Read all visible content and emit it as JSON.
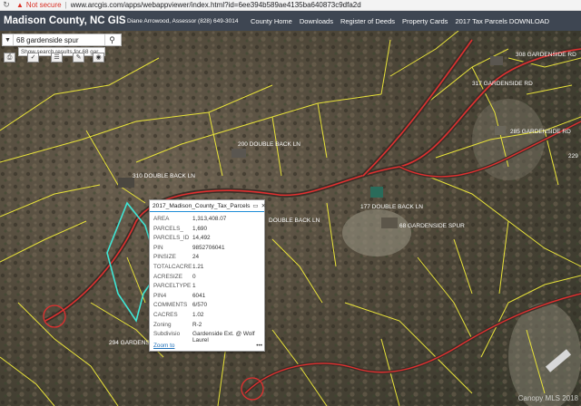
{
  "browser": {
    "security_label": "Not secure",
    "url": "www.arcgis.com/apps/webappviewer/index.html?id=6ee394b589ae4135ba640873c9dfa2d"
  },
  "header": {
    "title": "Madison County, NC GIS",
    "assessor": "Diane Arrowood, Assessor (828) 649-3014",
    "nav": [
      "County Home",
      "Downloads",
      "Register of Deeds",
      "Property Cards",
      "2017 Tax Parcels DOWNLOAD"
    ]
  },
  "search": {
    "value": "68 gardenside spur",
    "suggestion": "Show search results for 68 gar..."
  },
  "map_labels": [
    "308 GARDENSIDE RD",
    "317 GARDENSIDE RD",
    "285 GARDENSIDE RD",
    "229",
    "200 DOUBLE BACK LN",
    "310 DOUBLE BACK LN",
    "DOUBLE BACK LN",
    "177 DOUBLE BACK LN",
    "68 GARDENSIDE SPUR",
    "294 GARDENS"
  ],
  "popup": {
    "title": "2017_Madison_County_Tax_Parcels",
    "fields": [
      {
        "key": "AREA",
        "value": "1,313,408.07"
      },
      {
        "key": "PARCELS_",
        "value": "1,690"
      },
      {
        "key": "PARCELS_ID",
        "value": "14,492"
      },
      {
        "key": "PIN",
        "value": "9852706041"
      },
      {
        "key": "PINSIZE",
        "value": "24"
      },
      {
        "key": "TOTALCACRE",
        "value": "1.21"
      },
      {
        "key": "ACRESIZE",
        "value": "0"
      },
      {
        "key": "PARCELTYPE",
        "value": "1"
      },
      {
        "key": "PIN4",
        "value": "6041"
      },
      {
        "key": "COMMENTS",
        "value": "6/570"
      },
      {
        "key": "CACRES",
        "value": "1.02"
      },
      {
        "key": "Zoning",
        "value": "R-2"
      },
      {
        "key": "Subdivisio",
        "value": "Gardenside Ext. @ Wolf Laurel"
      }
    ],
    "zoom_to": "Zoom to",
    "more": "•••"
  },
  "watermark": "Canopy MLS 2018"
}
